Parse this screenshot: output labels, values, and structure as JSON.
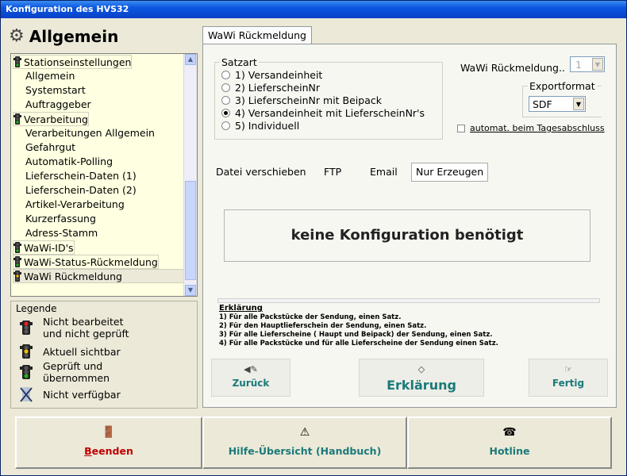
{
  "window": {
    "title": "Konfiguration des HVS32"
  },
  "left": {
    "header": "Allgemein",
    "tree": [
      {
        "label": "Stationseinstellungen",
        "level": 0
      },
      {
        "label": "Allgemein",
        "level": 1
      },
      {
        "label": "Systemstart",
        "level": 1
      },
      {
        "label": "Auftraggeber",
        "level": 1
      },
      {
        "label": "Verarbeitung",
        "level": 0
      },
      {
        "label": "Verarbeitungen Allgemein",
        "level": 1
      },
      {
        "label": "Gefahrgut",
        "level": 1
      },
      {
        "label": "Automatik-Polling",
        "level": 1
      },
      {
        "label": "Lieferschein-Daten (1)",
        "level": 1
      },
      {
        "label": "Lieferschein-Daten (2)",
        "level": 1
      },
      {
        "label": "Artikel-Verarbeitung",
        "level": 1
      },
      {
        "label": "Kurzerfassung",
        "level": 1
      },
      {
        "label": "Adress-Stamm",
        "level": 1
      },
      {
        "label": "WaWi-ID's",
        "level": 0
      },
      {
        "label": "WaWi-Status-Rückmeldung",
        "level": 0
      },
      {
        "label": "WaWi Rückmeldung",
        "level": 0
      }
    ],
    "legend": {
      "title": "Legende",
      "items": [
        {
          "line1": "Nicht bearbeitet",
          "line2": "und nicht geprüft"
        },
        {
          "line1": "Aktuell sichtbar",
          "line2": ""
        },
        {
          "line1": "Geprüft und",
          "line2": "übernommen"
        },
        {
          "line1": "Nicht verfügbar",
          "line2": ""
        }
      ]
    }
  },
  "tab": {
    "label": "WaWi Rückmeldung"
  },
  "satzart": {
    "title": "Satzart",
    "options": [
      "1) Versandeinheit",
      "2) LieferscheinNr",
      "3) LieferscheinNr mit Beipack",
      "4) Versandeinheit mit LieferscheinNr's",
      "5) Individuell"
    ],
    "selected_index": 3
  },
  "wawi_rueckmeldung": {
    "label": "WaWi Rückmeldung..",
    "value": "1"
  },
  "exportformat": {
    "label": "Exportformat",
    "value": "SDF"
  },
  "auto_checkbox": {
    "label": "automat. beim Tagesabschluss"
  },
  "datei": {
    "label": "Datei verschieben",
    "options": [
      "FTP",
      "Email",
      "Nur Erzeugen"
    ],
    "selected": "Nur Erzeugen"
  },
  "config_message": "keine Konfiguration benötigt",
  "erklaerung": {
    "title": "Erklärung",
    "lines": [
      "1) Für alle Packstücke der Sendung, einen Satz.",
      "2) Für den Hauptlieferschein der Sendung, einen Satz.",
      "3) Für alle Lieferscheine ( Haupt und Beipack) der Sendung, einen Satz.",
      "4) Für alle Packstücke und für alle Lieferscheine der Sendung einen Satz."
    ]
  },
  "nav": {
    "back": "Zurück",
    "explain": "Erklärung",
    "done": "Fertig"
  },
  "bottom": {
    "quit": "Beenden",
    "help": "Hilfe-Übersicht (Handbuch)",
    "hotline": "Hotline"
  },
  "colors": {
    "tree_bg": "#ffffe1",
    "title_bar": "#0c56e0",
    "accent_teal": "#1a7a7a",
    "quit_red": "#c00000"
  }
}
